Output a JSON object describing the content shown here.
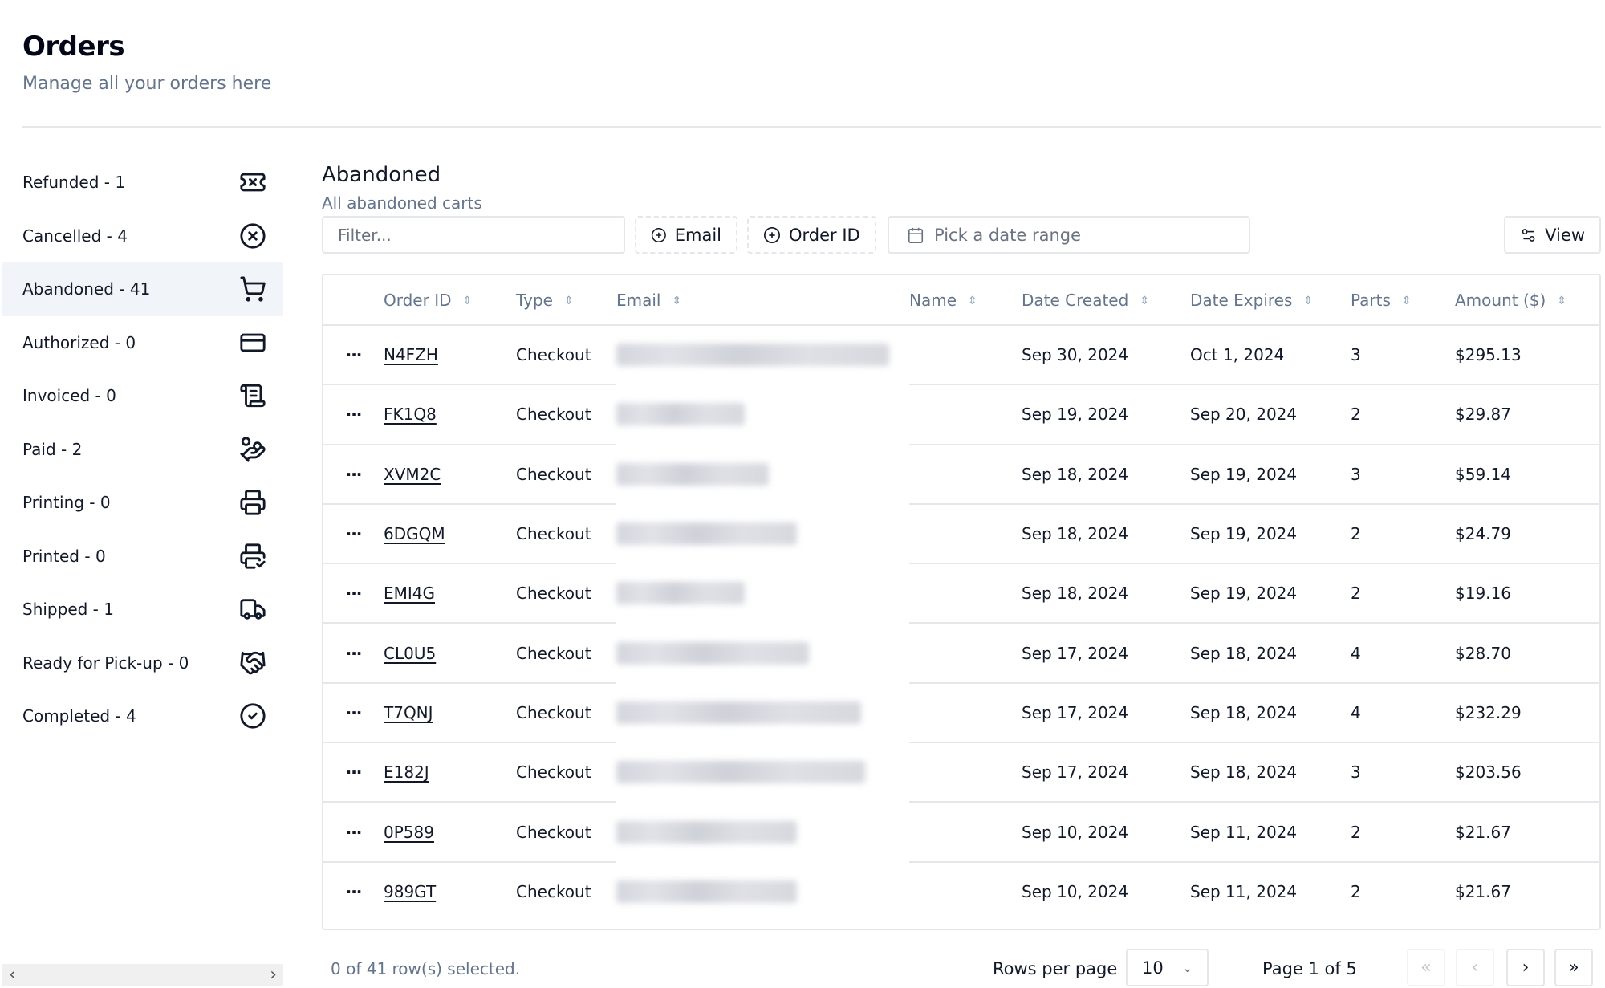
{
  "header": {
    "title": "Orders",
    "subtitle": "Manage all your orders here"
  },
  "sidebar": {
    "active_index": 2,
    "items": [
      {
        "label": "Refunded - 1",
        "icon": "ticket-x-icon"
      },
      {
        "label": "Cancelled - 4",
        "icon": "circle-x-icon"
      },
      {
        "label": "Abandoned - 41",
        "icon": "shopping-cart-icon"
      },
      {
        "label": "Authorized - 0",
        "icon": "credit-card-icon"
      },
      {
        "label": "Invoiced - 0",
        "icon": "scroll-text-icon"
      },
      {
        "label": "Paid - 2",
        "icon": "hand-coins-icon"
      },
      {
        "label": "Printing - 0",
        "icon": "printer-icon"
      },
      {
        "label": "Printed - 0",
        "icon": "printer-check-icon"
      },
      {
        "label": "Shipped - 1",
        "icon": "truck-icon"
      },
      {
        "label": "Ready for Pick-up - 0",
        "icon": "handshake-icon"
      },
      {
        "label": "Completed - 4",
        "icon": "circle-check-icon"
      }
    ],
    "scroll_left": "‹",
    "scroll_right": "›"
  },
  "main": {
    "title": "Abandoned",
    "subtitle": "All abandoned carts",
    "toolbar": {
      "filter_placeholder": "Filter...",
      "filter_value": "",
      "email_facet": "Email",
      "order_id_facet": "Order ID",
      "date_range_placeholder": "Pick a date range",
      "view_label": "View"
    },
    "table": {
      "columns": [
        "",
        "Order ID",
        "Type",
        "Email",
        "Name",
        "Date Created",
        "Date Expires",
        "Parts",
        "Amount ($)"
      ],
      "sort_glyph": "⇕",
      "actions_glyph": "···",
      "rows": [
        {
          "order_id": "N4FZH",
          "type": "Checkout",
          "email": "[redacted]",
          "name": "",
          "date_created": "Sep 30, 2024",
          "date_expires": "Oct 1, 2024",
          "parts": "3",
          "amount": "$295.13"
        },
        {
          "order_id": "FK1Q8",
          "type": "Checkout",
          "email": "[redacted]",
          "name": "",
          "date_created": "Sep 19, 2024",
          "date_expires": "Sep 20, 2024",
          "parts": "2",
          "amount": "$29.87"
        },
        {
          "order_id": "XVM2C",
          "type": "Checkout",
          "email": "[redacted]",
          "name": "",
          "date_created": "Sep 18, 2024",
          "date_expires": "Sep 19, 2024",
          "parts": "3",
          "amount": "$59.14"
        },
        {
          "order_id": "6DGQM",
          "type": "Checkout",
          "email": "[redacted]",
          "name": "",
          "date_created": "Sep 18, 2024",
          "date_expires": "Sep 19, 2024",
          "parts": "2",
          "amount": "$24.79"
        },
        {
          "order_id": "EMI4G",
          "type": "Checkout",
          "email": "[redacted]",
          "name": "",
          "date_created": "Sep 18, 2024",
          "date_expires": "Sep 19, 2024",
          "parts": "2",
          "amount": "$19.16"
        },
        {
          "order_id": "CL0U5",
          "type": "Checkout",
          "email": "[redacted]",
          "name": "",
          "date_created": "Sep 17, 2024",
          "date_expires": "Sep 18, 2024",
          "parts": "4",
          "amount": "$28.70"
        },
        {
          "order_id": "T7QNJ",
          "type": "Checkout",
          "email": "[redacted]",
          "name": "",
          "date_created": "Sep 17, 2024",
          "date_expires": "Sep 18, 2024",
          "parts": "4",
          "amount": "$232.29"
        },
        {
          "order_id": "E182J",
          "type": "Checkout",
          "email": "[redacted]",
          "name": "",
          "date_created": "Sep 17, 2024",
          "date_expires": "Sep 18, 2024",
          "parts": "3",
          "amount": "$203.56"
        },
        {
          "order_id": "0P589",
          "type": "Checkout",
          "email": "[redacted]",
          "name": "",
          "date_created": "Sep 10, 2024",
          "date_expires": "Sep 11, 2024",
          "parts": "2",
          "amount": "$21.67"
        },
        {
          "order_id": "989GT",
          "type": "Checkout",
          "email": "[redacted]",
          "name": "",
          "date_created": "Sep 10, 2024",
          "date_expires": "Sep 11, 2024",
          "parts": "2",
          "amount": "$21.67"
        }
      ]
    },
    "footer": {
      "selected_text": "0 of 41 row(s) selected.",
      "rows_per_page_label": "Rows per page",
      "rows_per_page_value": "10",
      "page_text": "Page 1 of 5",
      "first_glyph": "«",
      "prev_glyph": "‹",
      "next_glyph": "›",
      "last_glyph": "»"
    }
  }
}
